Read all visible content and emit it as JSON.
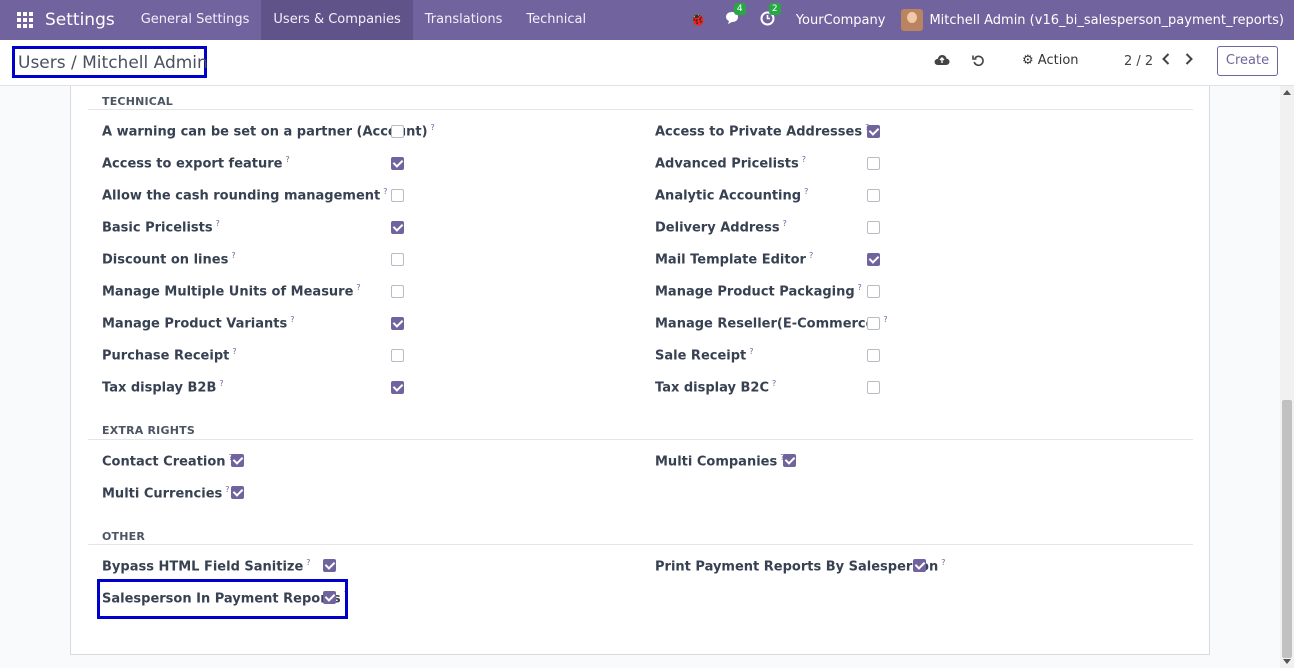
{
  "navbar": {
    "app_name": "Settings",
    "menu": [
      "General Settings",
      "Users & Companies",
      "Translations",
      "Technical"
    ],
    "active_menu": "Users & Companies",
    "messages_badge": "4",
    "activities_badge": "2",
    "company": "YourCompany",
    "user": "Mitchell Admin (v16_bi_salesperson_payment_reports)"
  },
  "control_panel": {
    "breadcrumb": "Users / Mitchell Admin",
    "action_label": "Action",
    "pager": "2 / 2",
    "create_label": "Create"
  },
  "sections": {
    "technical": {
      "title": "TECHNICAL",
      "left": [
        {
          "label": "A warning can be set on a partner (Account)",
          "checked": false
        },
        {
          "label": "Access to export feature",
          "checked": true
        },
        {
          "label": "Allow the cash rounding management",
          "checked": false
        },
        {
          "label": "Basic Pricelists",
          "checked": true
        },
        {
          "label": "Discount on lines",
          "checked": false
        },
        {
          "label": "Manage Multiple Units of Measure",
          "checked": false
        },
        {
          "label": "Manage Product Variants",
          "checked": true
        },
        {
          "label": "Purchase Receipt",
          "checked": false
        },
        {
          "label": "Tax display B2B",
          "checked": true
        }
      ],
      "right": [
        {
          "label": "Access to Private Addresses",
          "checked": true
        },
        {
          "label": "Advanced Pricelists",
          "checked": false
        },
        {
          "label": "Analytic Accounting",
          "checked": false
        },
        {
          "label": "Delivery Address",
          "checked": false
        },
        {
          "label": "Mail Template Editor",
          "checked": true
        },
        {
          "label": "Manage Product Packaging",
          "checked": false
        },
        {
          "label": "Manage Reseller(E-Commerce)",
          "checked": false
        },
        {
          "label": "Sale Receipt",
          "checked": false
        },
        {
          "label": "Tax display B2C",
          "checked": false
        }
      ]
    },
    "extra_rights": {
      "title": "EXTRA RIGHTS",
      "left": [
        {
          "label": "Contact Creation",
          "checked": true
        },
        {
          "label": "Multi Currencies",
          "checked": true
        }
      ],
      "right": [
        {
          "label": "Multi Companies",
          "checked": true
        }
      ]
    },
    "other": {
      "title": "OTHER",
      "left": [
        {
          "label": "Bypass HTML Field Sanitize",
          "checked": true
        },
        {
          "label": "Salesperson In Payment Reports",
          "checked": true
        }
      ],
      "right": [
        {
          "label": "Print Payment Reports By Salesperson",
          "checked": true
        }
      ]
    }
  },
  "help_marker": "?",
  "colors": {
    "brand": "#71639e",
    "highlight": "#0000cc"
  }
}
